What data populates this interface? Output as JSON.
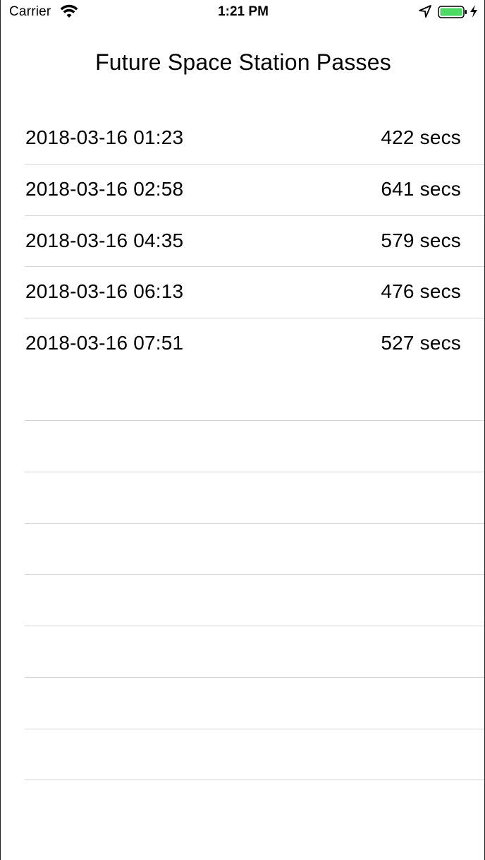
{
  "status_bar": {
    "carrier": "Carrier",
    "time": "1:21 PM",
    "icons": [
      "wifi-icon",
      "location-arrow-icon",
      "battery-icon",
      "charging-bolt-icon"
    ],
    "battery_color": "#4cd964"
  },
  "screen": {
    "title": "Future Space Station Passes"
  },
  "passes": [
    {
      "date": "2018-03-16 01:23",
      "duration": "422 secs"
    },
    {
      "date": "2018-03-16 02:58",
      "duration": "641 secs"
    },
    {
      "date": "2018-03-16 04:35",
      "duration": "579 secs"
    },
    {
      "date": "2018-03-16 06:13",
      "duration": "476 secs"
    },
    {
      "date": "2018-03-16 07:51",
      "duration": "527 secs"
    }
  ]
}
